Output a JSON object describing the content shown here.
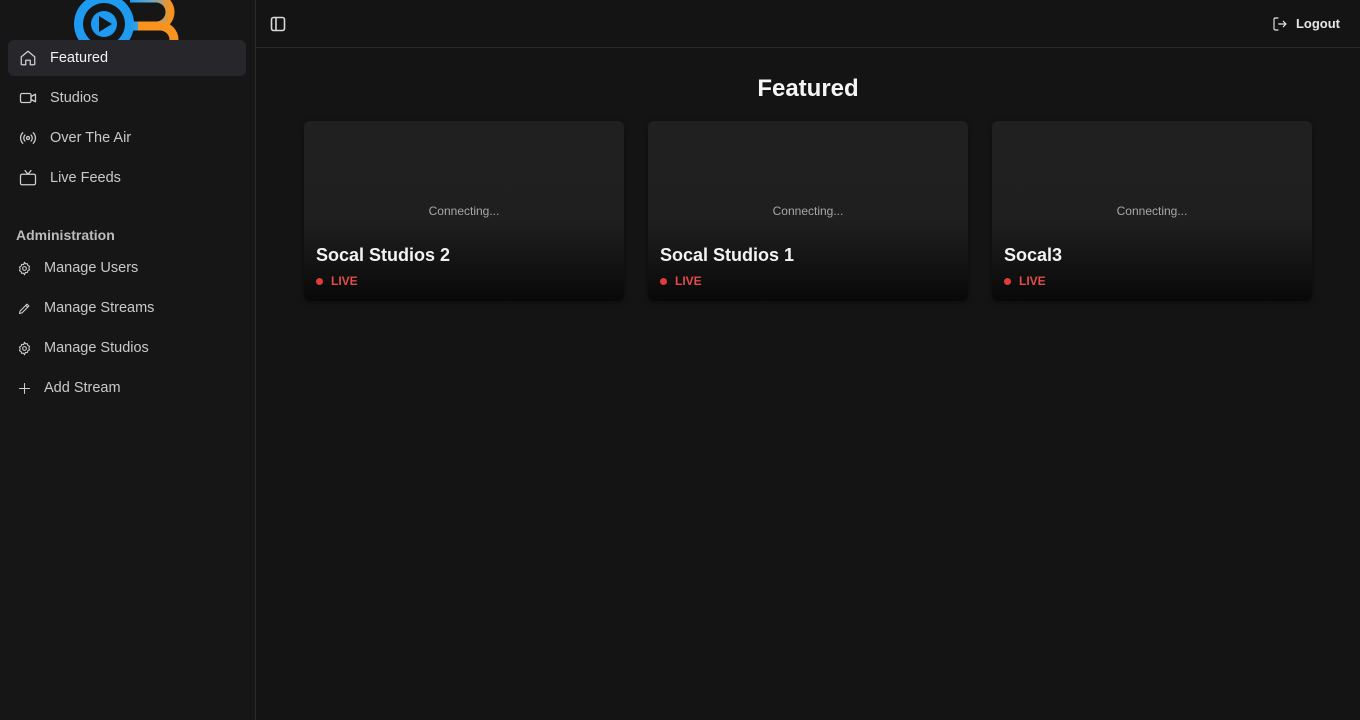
{
  "sidebar": {
    "nav": [
      {
        "label": "Featured",
        "icon": "home-icon",
        "active": true
      },
      {
        "label": "Studios",
        "icon": "video-camera-icon"
      },
      {
        "label": "Over The Air",
        "icon": "radio-broadcast-icon"
      },
      {
        "label": "Live Feeds",
        "icon": "tv-icon"
      }
    ],
    "admin_label": "Administration",
    "admin": [
      {
        "label": "Manage Users",
        "icon": "gear-icon"
      },
      {
        "label": "Manage Streams",
        "icon": "pencil-icon"
      },
      {
        "label": "Manage Studios",
        "icon": "gear-icon"
      },
      {
        "label": "Add Stream",
        "icon": "plus-icon"
      }
    ]
  },
  "header": {
    "logout_label": "Logout"
  },
  "main": {
    "title": "Featured",
    "cards": [
      {
        "title": "Socal Studios 2",
        "status": "Connecting...",
        "badge": "LIVE"
      },
      {
        "title": "Socal Studios 1",
        "status": "Connecting...",
        "badge": "LIVE"
      },
      {
        "title": "Socal3",
        "status": "Connecting...",
        "badge": "LIVE"
      }
    ]
  },
  "colors": {
    "background": "#141414",
    "sidebar": "#161616",
    "active_item": "#27262b",
    "live_red": "#e34a4a",
    "logo_blue": "#1e9bf0",
    "logo_orange": "#f7931e"
  }
}
